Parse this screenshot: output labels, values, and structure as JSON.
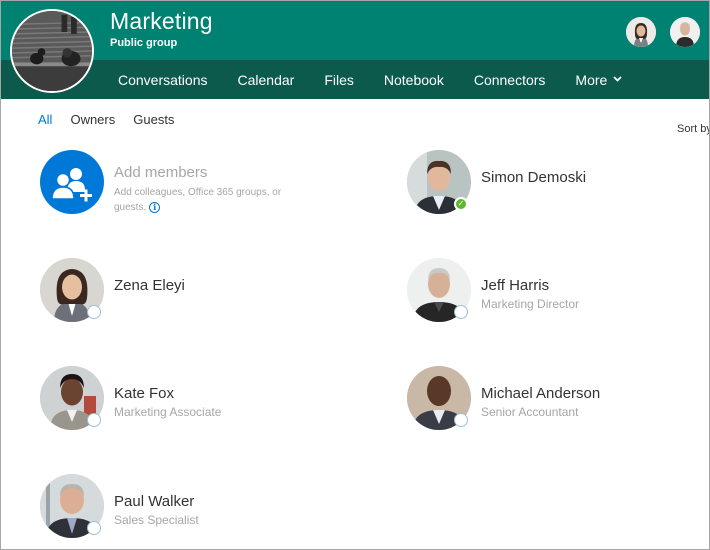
{
  "group": {
    "title": "Marketing",
    "subtitle": "Public group"
  },
  "header": {
    "avatars": [
      {
        "name": "Zena Eleyi"
      },
      {
        "name": "Jeff Harris"
      }
    ]
  },
  "nav": {
    "items": [
      {
        "label": "Conversations"
      },
      {
        "label": "Calendar"
      },
      {
        "label": "Files"
      },
      {
        "label": "Notebook"
      },
      {
        "label": "Connectors"
      },
      {
        "label": "More",
        "icon": "chevron-down-icon"
      }
    ]
  },
  "filters": {
    "items": [
      {
        "label": "All",
        "active": true
      },
      {
        "label": "Owners",
        "active": false
      },
      {
        "label": "Guests",
        "active": false
      }
    ]
  },
  "sort": {
    "label": "Sort by"
  },
  "add_members": {
    "title": "Add members",
    "description": "Add colleagues, Office 365 groups, or guests.",
    "info_icon": "i"
  },
  "members": [
    {
      "name": "Simon Demoski",
      "title": "",
      "presence": "available",
      "presence_glyph": "✓"
    },
    {
      "name": "Zena Eleyi",
      "title": "",
      "presence": "offline"
    },
    {
      "name": "Jeff Harris",
      "title": "Marketing Director",
      "presence": "offline"
    },
    {
      "name": "Kate Fox",
      "title": "Marketing Associate",
      "presence": "offline"
    },
    {
      "name": "Michael Anderson",
      "title": "Senior Accountant",
      "presence": "offline"
    },
    {
      "name": "Paul Walker",
      "title": "Sales Specialist",
      "presence": "offline"
    }
  ]
}
